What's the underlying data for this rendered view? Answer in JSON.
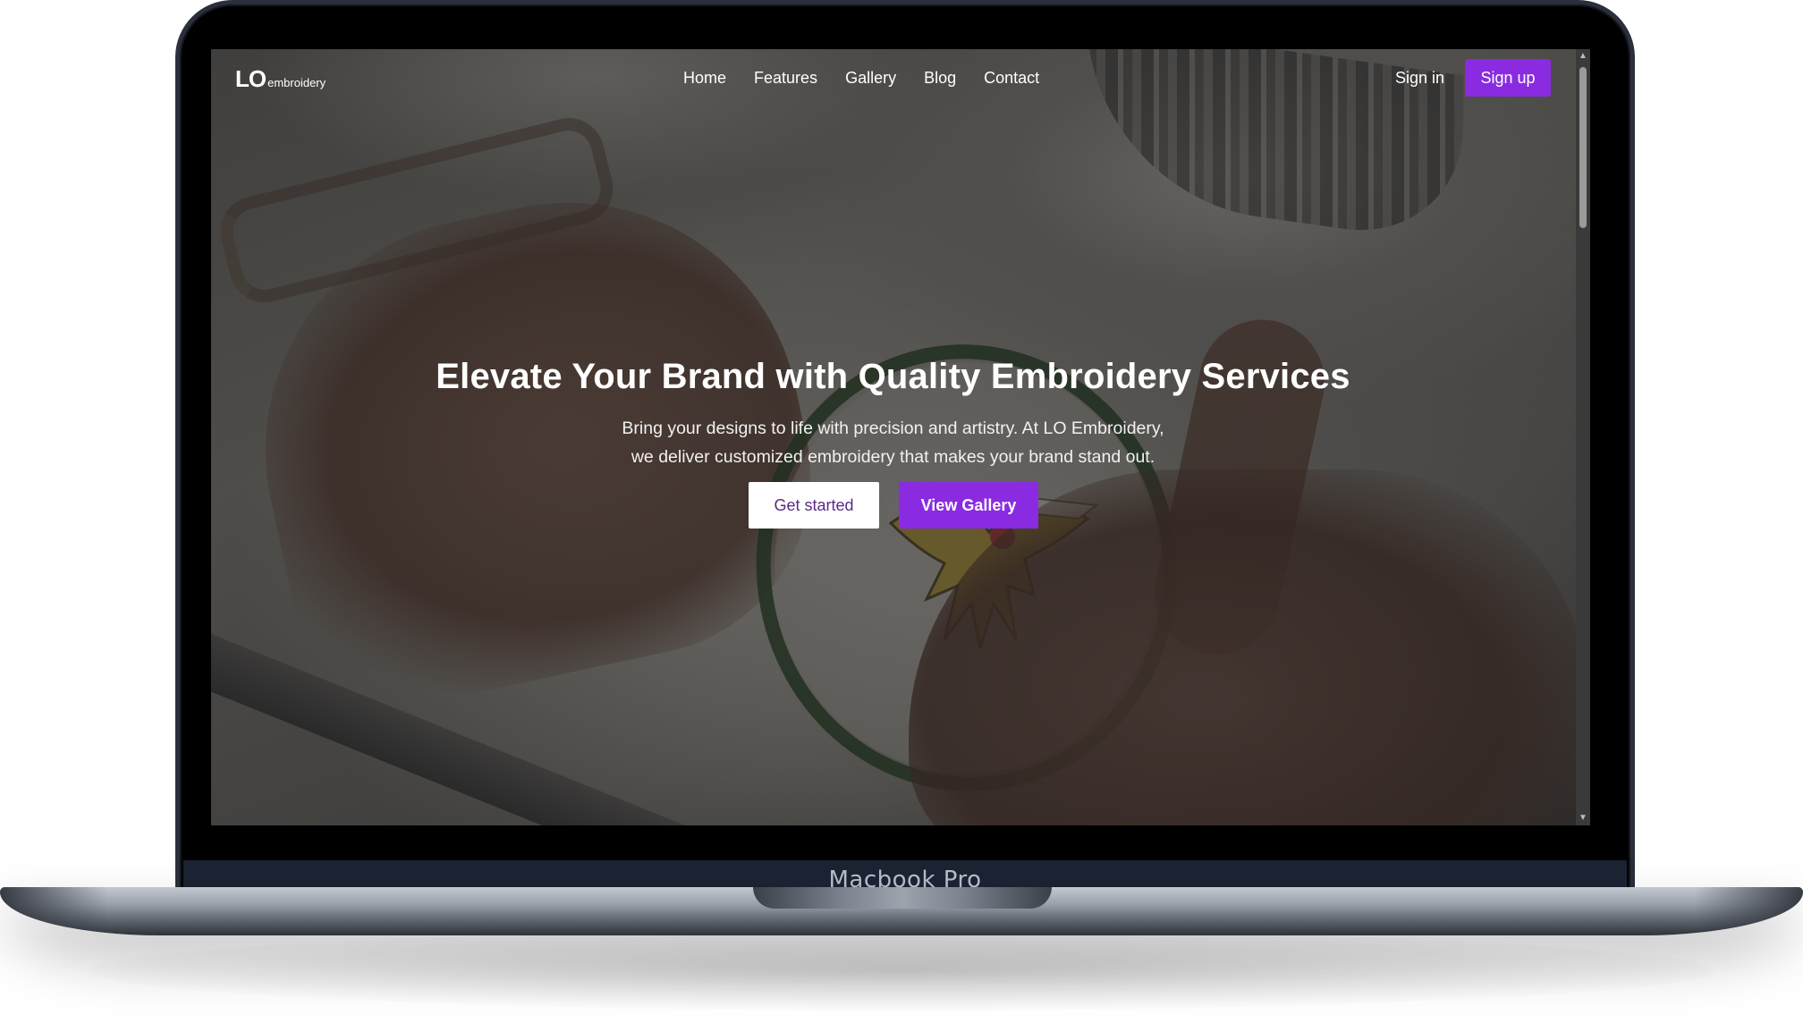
{
  "device": {
    "label": "Macbook Pro"
  },
  "site": {
    "logo_main": "LO",
    "logo_sub": "embroidery"
  },
  "nav": {
    "links": [
      "Home",
      "Features",
      "Gallery",
      "Blog",
      "Contact"
    ],
    "signin_label": "Sign in",
    "signup_label": "Sign up"
  },
  "hero": {
    "title": "Elevate Your Brand with Quality Embroidery Services",
    "subtitle_line1": "Bring your designs to life with precision and artistry. At LO Embroidery,",
    "subtitle_line2": "we deliver customized embroidery that makes your brand stand out.",
    "primary_button": "Get started",
    "secondary_button": "View Gallery"
  },
  "scrollbar": {
    "up_icon": "▲",
    "down_icon": "▼"
  },
  "colors": {
    "accent": "#8a2be2",
    "primary_button_text": "#5b2a86"
  }
}
